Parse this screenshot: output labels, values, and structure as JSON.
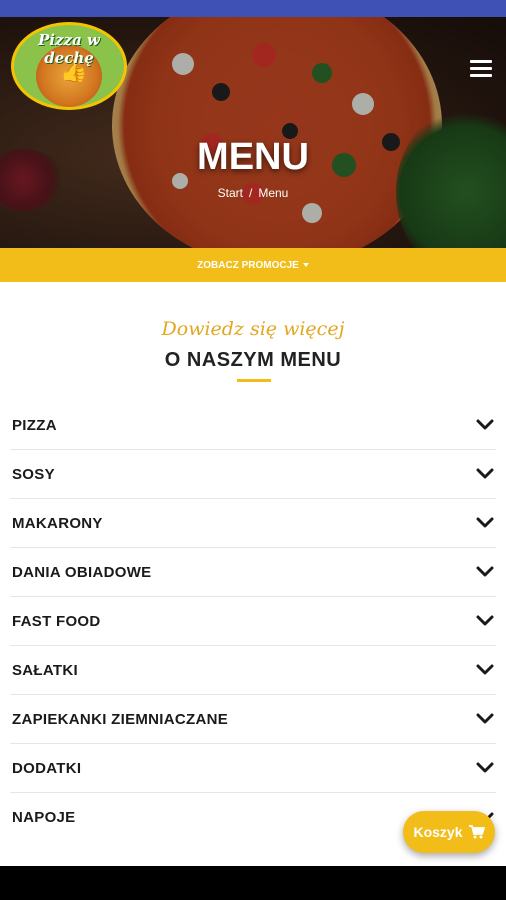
{
  "logo": {
    "text": "Pizza w dechę"
  },
  "hero": {
    "title": "MENU"
  },
  "breadcrumb": {
    "items": [
      "Start",
      "Menu"
    ],
    "separator": "/"
  },
  "promo": {
    "label": "ZOBACZ PROMOCJE"
  },
  "section": {
    "subtitle": "Dowiedz się więcej",
    "title": "O NASZYM MENU"
  },
  "menu": {
    "categories": [
      "PIZZA",
      "SOSY",
      "MAKARONY",
      "DANIA OBIADOWE",
      "FAST FOOD",
      "SAŁATKI",
      "ZAPIEKANKI ZIEMNIACZANE",
      "DODATKI",
      "NAPOJE"
    ]
  },
  "cart": {
    "label": "Koszyk"
  },
  "colors": {
    "accent": "#f2bd19",
    "statusbar": "#3f51b5",
    "text": "#1a1a1a"
  },
  "icons": {
    "menu": "hamburger-icon",
    "chevron": "chevron-down-icon",
    "cart": "cart-icon"
  }
}
